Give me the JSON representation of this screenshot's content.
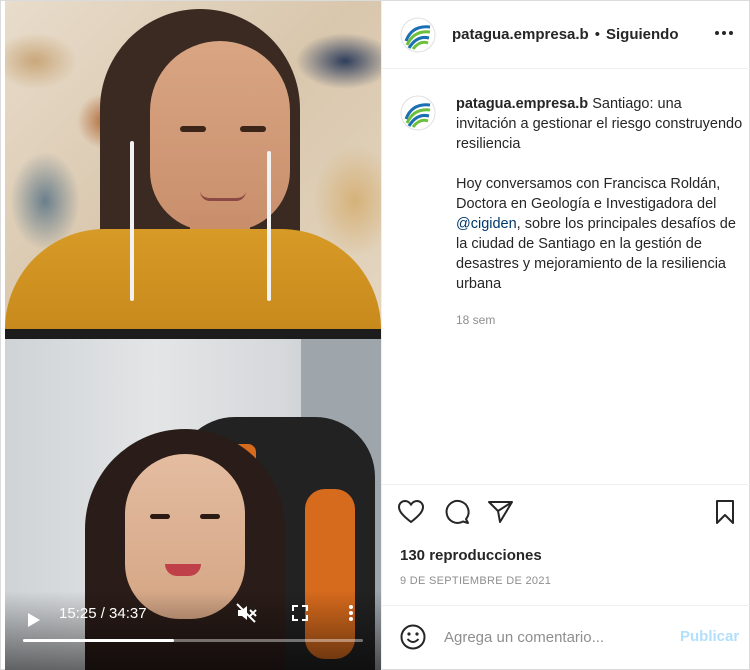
{
  "post": {
    "username": "patagua.empresa.b",
    "separator": "•",
    "follow_label": "Siguiendo",
    "caption_title": "Santiago: una invitación a gestionar el riesgo construyendo resiliencia",
    "caption_body_before": "Hoy conversamos con Francisca Roldán, Doctora en Geología e Investigadora del ",
    "caption_mention": "@cigiden",
    "caption_body_after": ", sobre los principales desafíos de la ciudad de Santiago en la gestión de desastres y mejoramiento de la resiliencia urbana",
    "time_ago": "18 sem",
    "views": "130 reproducciones",
    "date": "9 DE SEPTIEMBRE DE 2021"
  },
  "video": {
    "time_display": "15:25 / 34:37",
    "progress": 0.445
  },
  "comment": {
    "placeholder": "Agrega un comentario...",
    "publish_label": "Publicar"
  },
  "icons": {
    "play": "play-icon",
    "mute": "muted-speaker-icon",
    "fullscreen": "fullscreen-icon",
    "more": "more-vertical-icon",
    "like": "heart-icon",
    "comment": "comment-bubble-icon",
    "share": "paper-plane-icon",
    "save": "bookmark-icon",
    "options": "more-horizontal-icon",
    "emoji": "smiley-icon"
  },
  "colors": {
    "mention": "#00376b",
    "publish_disabled": "#b2dffc",
    "secondary_text": "#8e8e8e",
    "logo_green": "#6cbf3c",
    "logo_blue": "#1b6fb3"
  }
}
